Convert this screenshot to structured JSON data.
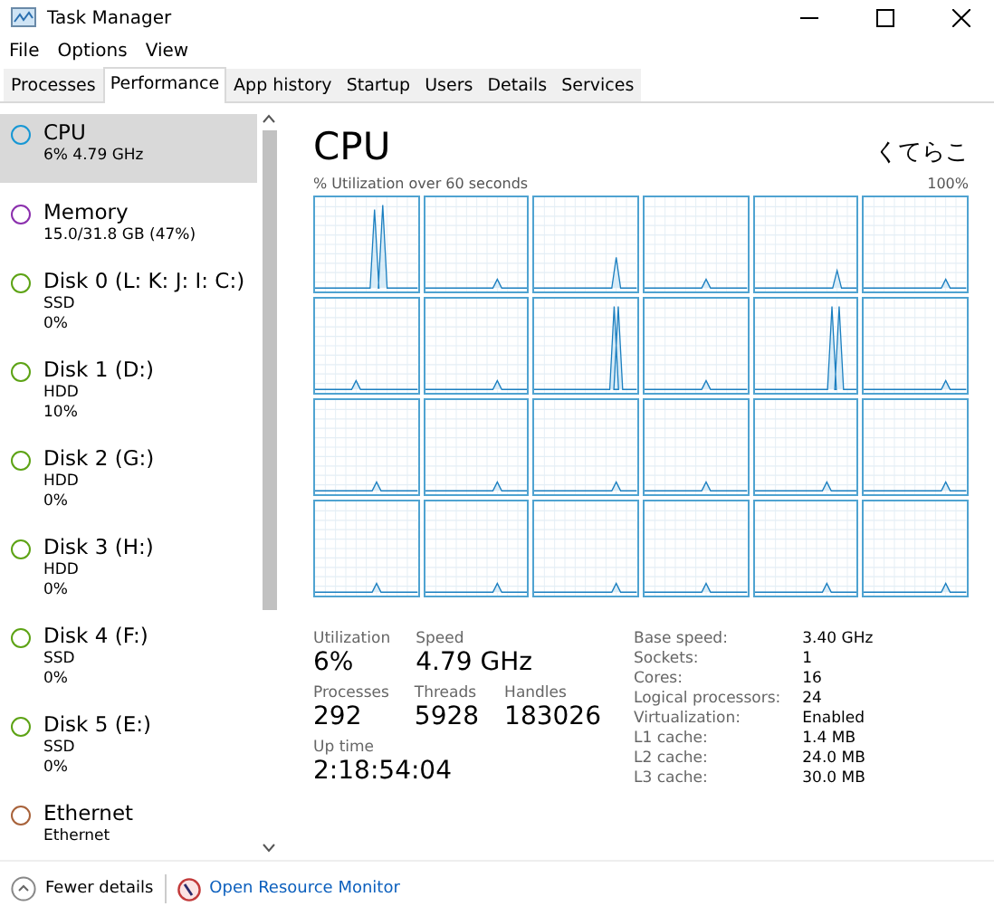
{
  "window": {
    "title": "Task Manager"
  },
  "menu": [
    "File",
    "Options",
    "View"
  ],
  "tabs": [
    {
      "label": "Processes",
      "selected": false
    },
    {
      "label": "Performance",
      "selected": true
    },
    {
      "label": "App history",
      "selected": false
    },
    {
      "label": "Startup",
      "selected": false
    },
    {
      "label": "Users",
      "selected": false
    },
    {
      "label": "Details",
      "selected": false
    },
    {
      "label": "Services",
      "selected": false
    }
  ],
  "sidebar": {
    "items": [
      {
        "name": "CPU",
        "lines": [
          "6% 4.79 GHz"
        ],
        "color": "#1797d4",
        "selected": true
      },
      {
        "name": "Memory",
        "lines": [
          "15.0/31.8 GB (47%)"
        ],
        "color": "#8b2fad",
        "selected": false
      },
      {
        "name": "Disk 0 (L: K: J: I: C:)",
        "lines": [
          "SSD",
          "0%"
        ],
        "color": "#5da315",
        "selected": false
      },
      {
        "name": "Disk 1 (D:)",
        "lines": [
          "HDD",
          "10%"
        ],
        "color": "#5da315",
        "selected": false
      },
      {
        "name": "Disk 2 (G:)",
        "lines": [
          "HDD",
          "0%"
        ],
        "color": "#5da315",
        "selected": false
      },
      {
        "name": "Disk 3 (H:)",
        "lines": [
          "HDD",
          "0%"
        ],
        "color": "#5da315",
        "selected": false
      },
      {
        "name": "Disk 4 (F:)",
        "lines": [
          "SSD",
          "0%"
        ],
        "color": "#5da315",
        "selected": false
      },
      {
        "name": "Disk 5 (E:)",
        "lines": [
          "SSD",
          "0%"
        ],
        "color": "#5da315",
        "selected": false
      },
      {
        "name": "Ethernet",
        "lines": [
          "Ethernet"
        ],
        "color": "#a8623a",
        "selected": false
      }
    ]
  },
  "panel": {
    "title": "CPU",
    "model": "くてらこ",
    "graph_label": "% Utilization over 60 seconds",
    "graph_max": "100%",
    "stats": [
      {
        "label": "Utilization",
        "value": "6%"
      },
      {
        "label": "Speed",
        "value": "4.79 GHz"
      }
    ],
    "stats2": [
      {
        "label": "Processes",
        "value": "292"
      },
      {
        "label": "Threads",
        "value": "5928"
      },
      {
        "label": "Handles",
        "value": "183026"
      }
    ],
    "uptime": {
      "label": "Up time",
      "value": "2:18:54:04"
    },
    "specs": [
      {
        "label": "Base speed:",
        "value": "3.40 GHz"
      },
      {
        "label": "Sockets:",
        "value": "1"
      },
      {
        "label": "Cores:",
        "value": "16"
      },
      {
        "label": "Logical processors:",
        "value": "24"
      },
      {
        "label": "Virtualization:",
        "value": "Enabled"
      },
      {
        "label": "L1 cache:",
        "value": "1.4 MB"
      },
      {
        "label": "L2 cache:",
        "value": "24.0 MB"
      },
      {
        "label": "L3 cache:",
        "value": "30.0 MB"
      }
    ]
  },
  "footer": {
    "fewer": "Fewer details",
    "monitor": "Open Resource Monitor"
  }
}
